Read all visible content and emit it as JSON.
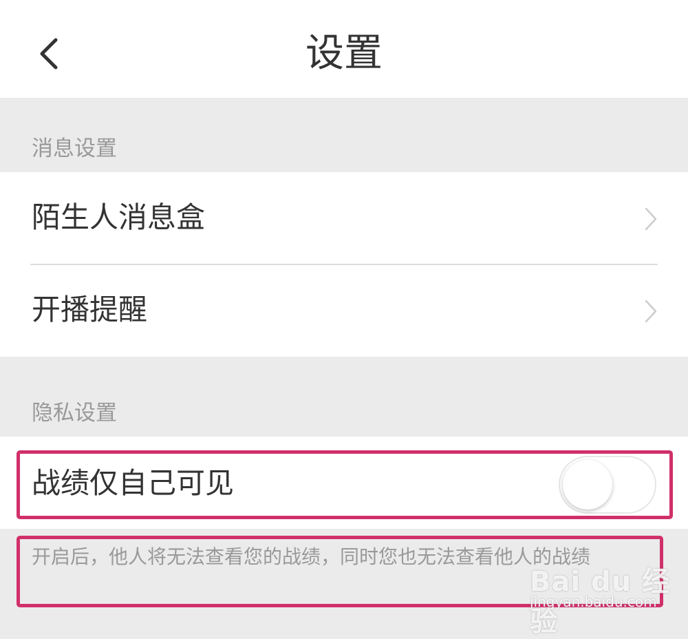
{
  "header": {
    "title": "设置",
    "back_icon": "chevron-left-icon"
  },
  "message_settings": {
    "section_title": "消息设置",
    "items": [
      {
        "label": "陌生人消息盒",
        "icon": "chevron-right-icon"
      },
      {
        "label": "开播提醒",
        "icon": "chevron-right-icon"
      }
    ]
  },
  "privacy_settings": {
    "section_title": "隐私设置",
    "toggle_item": {
      "label": "战绩仅自己可见",
      "enabled": false
    },
    "description": "开启后，他人将无法查看您的战绩，同时您也无法查看他人的战绩"
  },
  "watermark": {
    "logo": "Bai du 经验",
    "url": "jingyan.baidu.com"
  },
  "colors": {
    "background": "#ebebeb",
    "surface": "#ffffff",
    "text_primary": "#333333",
    "text_secondary": "#999999",
    "highlight": "#d0306a"
  }
}
